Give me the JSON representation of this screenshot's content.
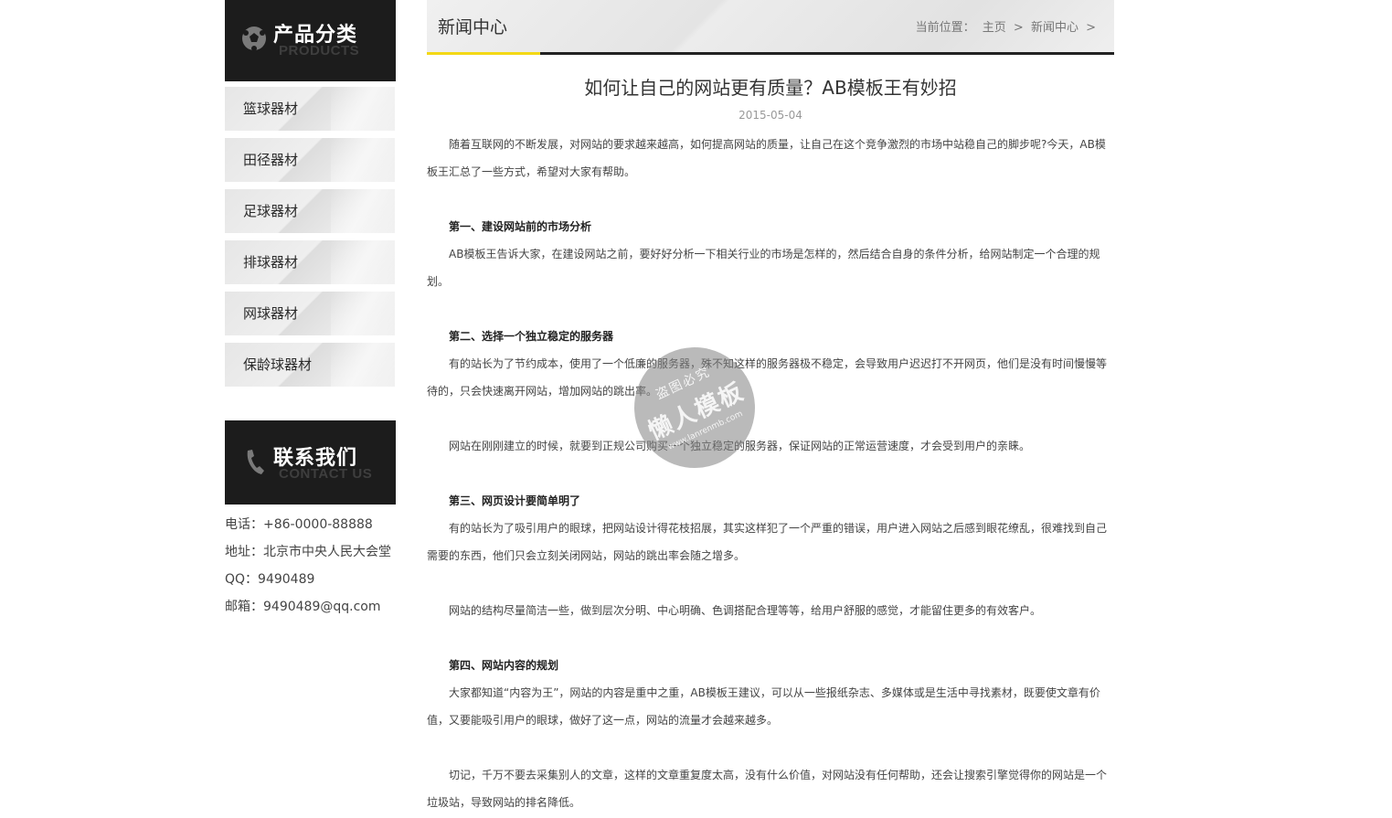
{
  "sidebar": {
    "products_heading": "产品分类",
    "products_sub": "PRODUCTS",
    "categories": [
      "篮球器材",
      "田径器材",
      "足球器材",
      "排球器材",
      "网球器材",
      "保龄球器材"
    ],
    "contact_heading": "联系我们",
    "contact_sub": "CONTACT US",
    "contact": {
      "phone": "电话：+86-0000-88888",
      "address": "地址：北京市中央人民大会堂",
      "qq": "QQ：9490489",
      "email": "邮箱：9490489@qq.com"
    }
  },
  "main": {
    "section_title": "新闻中心",
    "breadcrumb": {
      "prefix": "当前位置：",
      "home": "主页",
      "sep1": ">",
      "current": "新闻中心",
      "sep2": ">"
    },
    "article": {
      "title": "如何让自己的网站更有质量？AB模板王有妙招",
      "date": "2015-05-04",
      "paragraphs": [
        "随着互联网的不断发展，对网站的要求越来越高，如何提高网站的质量，让自己在这个竞争激烈的市场中站稳自己的脚步呢?今天，AB模板王汇总了一些方式，希望对大家有帮助。",
        "第一、建设网站前的市场分析",
        "AB模板王告诉大家，在建设网站之前，要好好分析一下相关行业的市场是怎样的，然后结合自身的条件分析，给网站制定一个合理的规划。",
        "第二、选择一个独立稳定的服务器",
        "有的站长为了节约成本，使用了一个低廉的服务器，殊不知这样的服务器极不稳定，会导致用户迟迟打不开网页，他们是没有时间慢慢等待的，只会快速离开网站，增加网站的跳出率。",
        "网站在刚刚建立的时候，就要到正规公司购买一个独立稳定的服务器，保证网站的正常运营速度，才会受到用户的亲睐。",
        "第三、网页设计要简单明了",
        "有的站长为了吸引用户的眼球，把网站设计得花枝招展，其实这样犯了一个严重的错误，用户进入网站之后感到眼花缭乱，很难找到自己需要的东西，他们只会立刻关闭网站，网站的跳出率会随之增多。",
        "网站的结构尽量简洁一些，做到层次分明、中心明确、色调搭配合理等等，给用户舒服的感觉，才能留住更多的有效客户。",
        "第四、网站内容的规划",
        "大家都知道“内容为王”，网站的内容是重中之重，AB模板王建议，可以从一些报纸杂志、多媒体或是生活中寻找素材，既要使文章有价值，又要能吸引用户的眼球，做好了这一点，网站的流量才会越来越多。",
        "切记，千万不要去采集别人的文章，这样的文章重复度太高，没有什么价值，对网站没有任何帮助，还会让搜索引擎觉得你的网站是一个垃圾站，导致网站的排名降低。"
      ]
    }
  },
  "watermark": {
    "line1": "盗图必究",
    "line2": "懒人模板",
    "line3": "www.lanrenmb.com"
  },
  "colors": {
    "accent_yellow": "#f3d815",
    "dark_block": "#1c1c1c"
  }
}
